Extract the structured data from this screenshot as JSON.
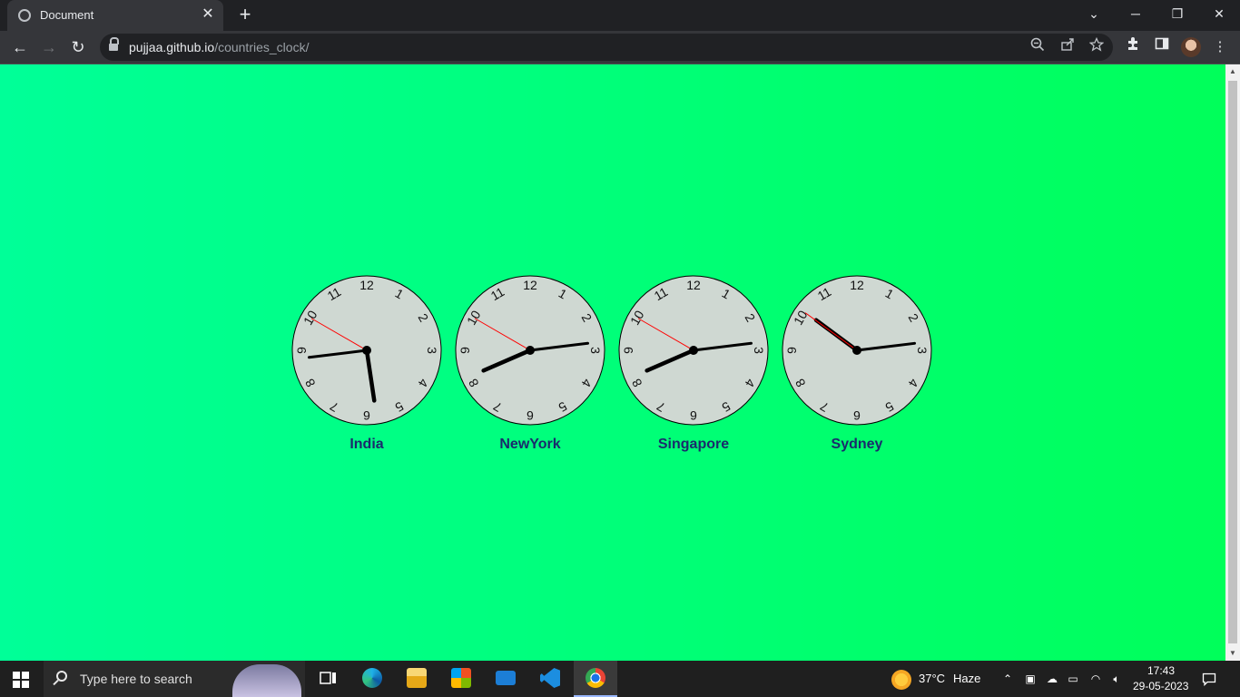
{
  "browser": {
    "tab_title": "Document",
    "close_glyph": "✕",
    "new_tab_glyph": "+",
    "url_domain": "pujjaa.github.io",
    "url_path": "/countries_clock/",
    "window_controls": {
      "minimize": "─",
      "restore": "❐",
      "close": "✕",
      "tab_search": "⌄"
    },
    "nav": {
      "back": "←",
      "forward": "→",
      "reload": "↻",
      "menu": "⋮"
    }
  },
  "page": {
    "background_start": "#00ff98",
    "background_end": "#00ff5a",
    "clocks": [
      {
        "label": "India",
        "hour": 5,
        "minute": 43,
        "second": 50
      },
      {
        "label": "NewYork",
        "hour": 8,
        "minute": 13,
        "second": 50
      },
      {
        "label": "Singapore",
        "hour": 8,
        "minute": 13,
        "second": 50
      },
      {
        "label": "Sydney",
        "hour": 10,
        "minute": 13,
        "second": 51
      }
    ]
  },
  "taskbar": {
    "search_placeholder": "Type here to search",
    "weather_temp": "37°C",
    "weather_desc": "Haze",
    "time": "17:43",
    "date": "29-05-2023"
  }
}
